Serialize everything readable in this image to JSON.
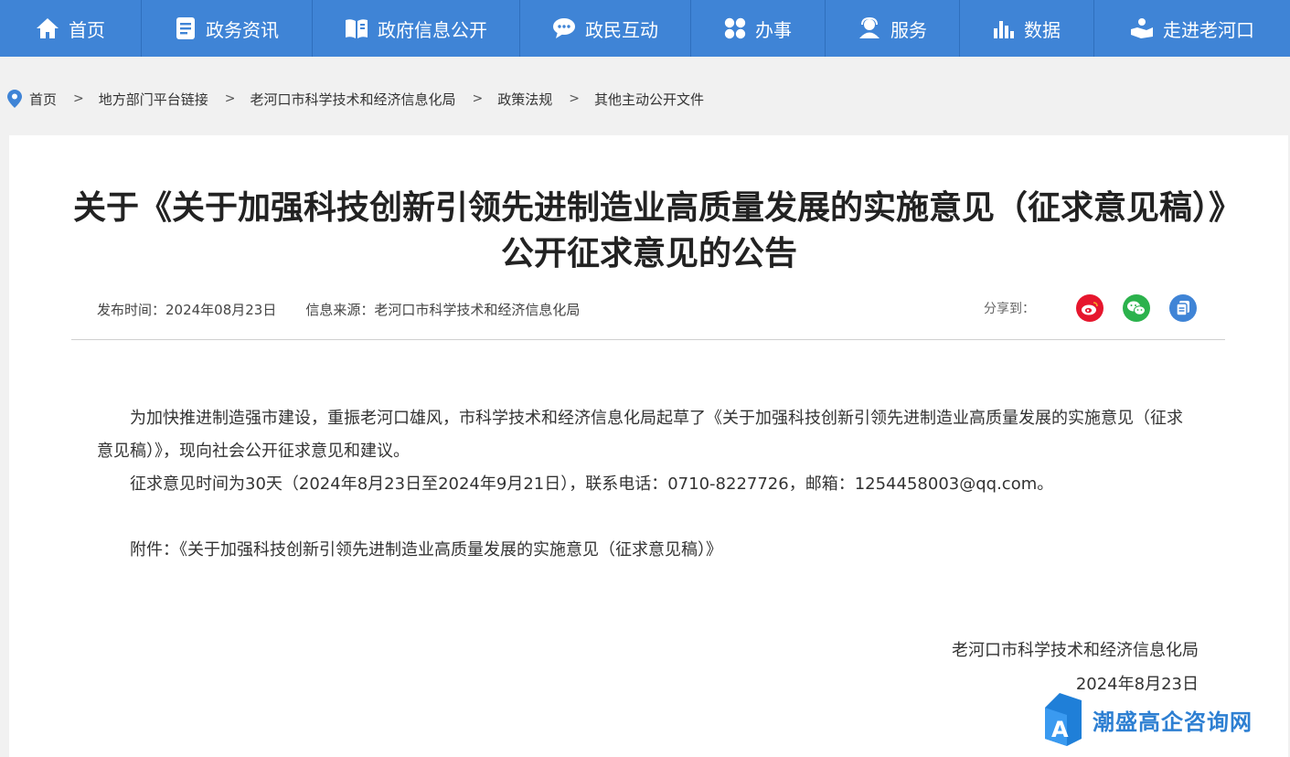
{
  "nav": {
    "items": [
      {
        "label": "首页",
        "icon": "home-icon"
      },
      {
        "label": "政务资讯",
        "icon": "document-icon"
      },
      {
        "label": "政府信息公开",
        "icon": "open-book-icon"
      },
      {
        "label": "政民互动",
        "icon": "chat-icon"
      },
      {
        "label": "办事",
        "icon": "grid-icon"
      },
      {
        "label": "服务",
        "icon": "service-person-icon"
      },
      {
        "label": "数据",
        "icon": "bar-chart-icon"
      },
      {
        "label": "走进老河口",
        "icon": "hand-icon"
      }
    ]
  },
  "breadcrumb": {
    "sep": ">",
    "items": [
      "首页",
      "地方部门平台链接",
      "老河口市科学技术和经济信息化局",
      "政策法规",
      "其他主动公开文件"
    ]
  },
  "article": {
    "title": "关于《关于加强科技创新引领先进制造业高质量发展的实施意见（征求意见稿）》公开征求意见的公告",
    "publish_label": "发布时间：2024年08月23日",
    "source_label": "信息来源：老河口市科学技术和经济信息化局",
    "share_label": "分享到：",
    "paragraph1": "为加快推进制造强市建设，重振老河口雄风，市科学技术和经济信息化局起草了《关于加强科技创新引领先进制造业高质量发展的实施意见（征求意见稿）》，现向社会公开征求意见和建议。",
    "paragraph2": "征求意见时间为30天（2024年8月23日至2024年9月21日），联系电话：0710-8227726，邮箱：1254458003@qq.com。",
    "attachment": "附件：《关于加强科技创新引领先进制造业高质量发展的实施意见（征求意见稿）》",
    "signature_org": "老河口市科学技术和经济信息化局",
    "signature_date": "2024年8月23日"
  },
  "watermark": {
    "text": "潮盛高企咨询网"
  },
  "colors": {
    "nav_bg": "#3f84d6",
    "weibo": "#e6162d",
    "wechat": "#2bb24c",
    "copy": "#3f84d6"
  }
}
